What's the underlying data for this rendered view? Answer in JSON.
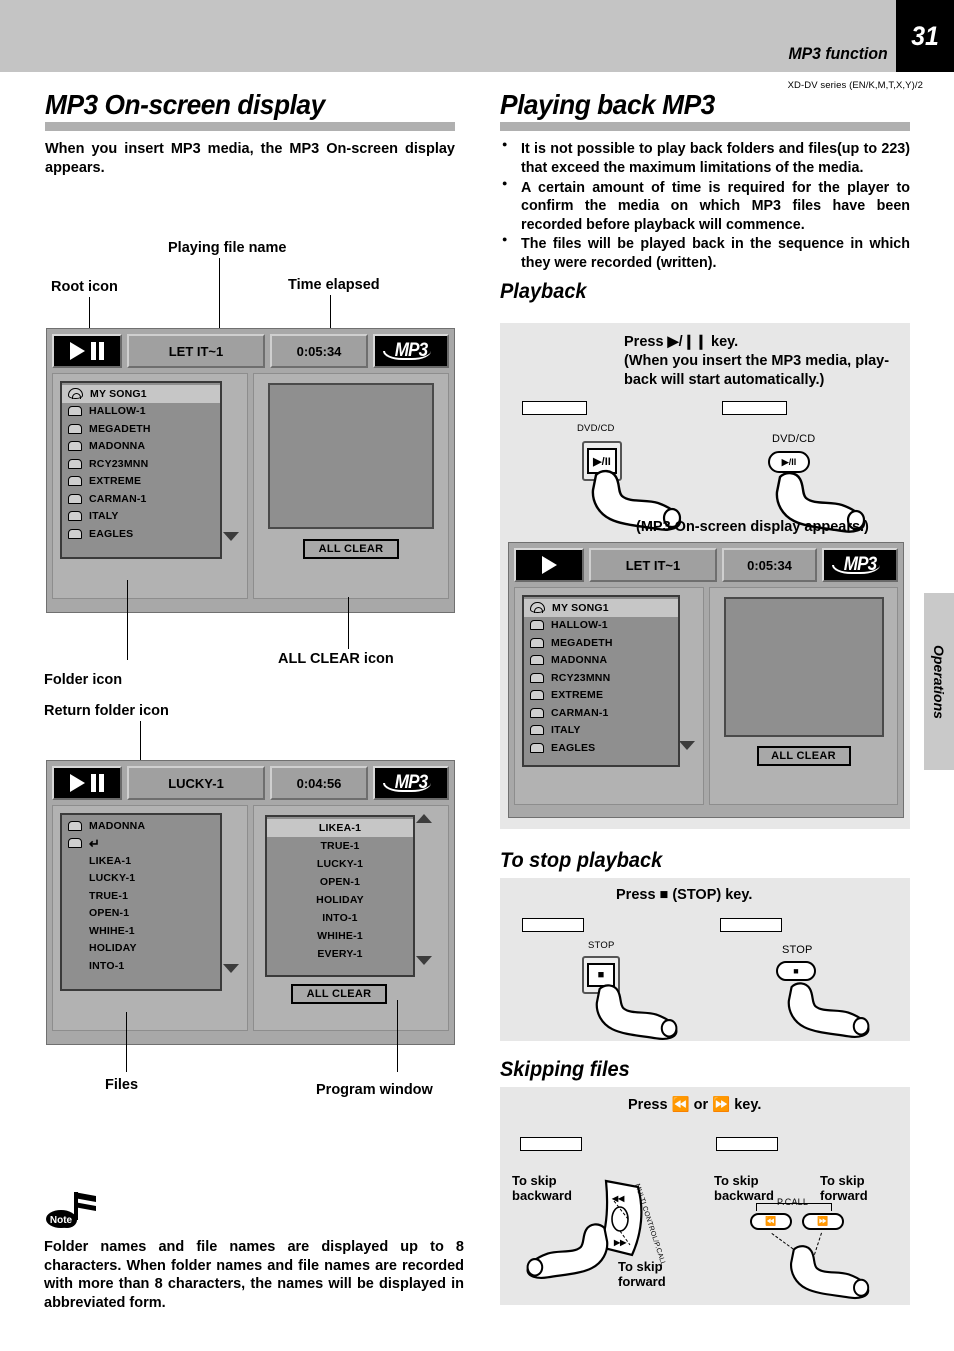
{
  "header": {
    "title": "MP3 function",
    "page_number": "31",
    "series": "XD-DV series (EN/K,M,T,X,Y)/2",
    "side_tab": "Operations"
  },
  "left_column": {
    "section_title": "MP3 On-screen display",
    "intro": "When you insert MP3 media, the MP3 On-screen display appears.",
    "callouts": {
      "playing_file_name": "Playing file name",
      "root_icon": "Root icon",
      "time_elapsed": "Time elapsed",
      "folder_icon": "Folder icon",
      "return_folder_icon": "Return folder icon",
      "all_clear_icon": "ALL CLEAR icon",
      "files": "Files",
      "program_window": "Program window"
    },
    "osd_folders": {
      "file_name": "LET IT~1",
      "time": "0:05:34",
      "logo": "MP3",
      "all_clear": "ALL CLEAR",
      "rows": [
        {
          "icon": "root-icon",
          "name": "MY SONG1",
          "selected": true
        },
        {
          "icon": "folder-icon",
          "name": "HALLOW-1",
          "selected": false
        },
        {
          "icon": "folder-icon",
          "name": "MEGADETH",
          "selected": false
        },
        {
          "icon": "folder-icon",
          "name": "MADONNA",
          "selected": false
        },
        {
          "icon": "folder-icon",
          "name": "RCY23MNN",
          "selected": false
        },
        {
          "icon": "folder-icon",
          "name": "EXTREME",
          "selected": false
        },
        {
          "icon": "folder-icon",
          "name": "CARMAN-1",
          "selected": false
        },
        {
          "icon": "folder-icon",
          "name": "ITALY",
          "selected": false
        },
        {
          "icon": "folder-icon",
          "name": "EAGLES",
          "selected": false
        }
      ]
    },
    "osd_files": {
      "file_name": "LUCKY-1",
      "time": "0:04:56",
      "logo": "MP3",
      "all_clear": "ALL CLEAR",
      "rows": [
        {
          "icon": "folder-icon",
          "name": "MADONNA",
          "selected": false
        },
        {
          "icon": "return-folder-icon",
          "name": "↵",
          "selected": false
        },
        {
          "icon": "none",
          "name": "LIKEA-1",
          "selected": false
        },
        {
          "icon": "none",
          "name": "LUCKY-1",
          "selected": false
        },
        {
          "icon": "none",
          "name": "TRUE-1",
          "selected": false
        },
        {
          "icon": "none",
          "name": "OPEN-1",
          "selected": false
        },
        {
          "icon": "none",
          "name": "WHIHE-1",
          "selected": false
        },
        {
          "icon": "none",
          "name": "HOLIDAY",
          "selected": false
        },
        {
          "icon": "none",
          "name": "INTO-1",
          "selected": false
        }
      ],
      "program_rows": [
        {
          "name": "LIKEA-1",
          "selected": true
        },
        {
          "name": "TRUE-1",
          "selected": false
        },
        {
          "name": "LUCKY-1",
          "selected": false
        },
        {
          "name": "OPEN-1",
          "selected": false
        },
        {
          "name": "HOLIDAY",
          "selected": false
        },
        {
          "name": "INTO-1",
          "selected": false
        },
        {
          "name": "WHIHE-1",
          "selected": false
        },
        {
          "name": "EVERY-1",
          "selected": false
        }
      ]
    },
    "note": "Folder names and file names are displayed up to 8 characters. When folder names and file names are recorded with more than 8 characters, the names will be displayed in abbreviated form.",
    "note_badge": "Note"
  },
  "right_column": {
    "section_title": "Playing back MP3",
    "bullets": [
      "It is not possible to play back folders and files(up to 223) that exceed the maximum limitations of the media.",
      "A certain amount of time is required for the player to confirm the media on which MP3 files have been recorded before playback will commence.",
      "The files will be played back in the sequence in which they were recorded (written)."
    ],
    "playback": {
      "heading": "Playback",
      "instruction_line1": "Press ▶/❙❙ key.",
      "instruction_line2": "(When you insert the MP3 media, play-",
      "instruction_line3": "back will start automatically.)",
      "unit_label": "DVD/CD",
      "remote_label": "DVD/CD",
      "key_face": "▶/II",
      "caption": "(MP3 On-screen display appears.)",
      "osd": {
        "file_name": "LET IT~1",
        "time": "0:05:34",
        "logo": "MP3",
        "all_clear": "ALL CLEAR",
        "rows": [
          {
            "icon": "root-icon",
            "name": "MY SONG1",
            "selected": true
          },
          {
            "icon": "folder-icon",
            "name": "HALLOW-1",
            "selected": false
          },
          {
            "icon": "folder-icon",
            "name": "MEGADETH",
            "selected": false
          },
          {
            "icon": "folder-icon",
            "name": "MADONNA",
            "selected": false
          },
          {
            "icon": "folder-icon",
            "name": "RCY23MNN",
            "selected": false
          },
          {
            "icon": "folder-icon",
            "name": "EXTREME",
            "selected": false
          },
          {
            "icon": "folder-icon",
            "name": "CARMAN-1",
            "selected": false
          },
          {
            "icon": "folder-icon",
            "name": "ITALY",
            "selected": false
          },
          {
            "icon": "folder-icon",
            "name": "EAGLES",
            "selected": false
          }
        ]
      }
    },
    "stop": {
      "heading": "To stop playback",
      "instruction": "Press ■ (STOP) key.",
      "unit_label": "STOP",
      "remote_label": "STOP",
      "key_face": "■"
    },
    "skip": {
      "heading": "Skipping files",
      "instruction": "Press ⏪  or  ⏩   key.",
      "unit_skip_backward": "To skip\nbackward",
      "unit_skip_forward": "To skip\nforward",
      "remote_skip_backward": "To skip\nbackward",
      "remote_skip_forward": "To skip\nforward",
      "dial_label": "MULTI CONTROL/P.CALL",
      "pcall_label": "P.CALL",
      "key_prev": "⏪",
      "key_next": "⏩"
    }
  }
}
